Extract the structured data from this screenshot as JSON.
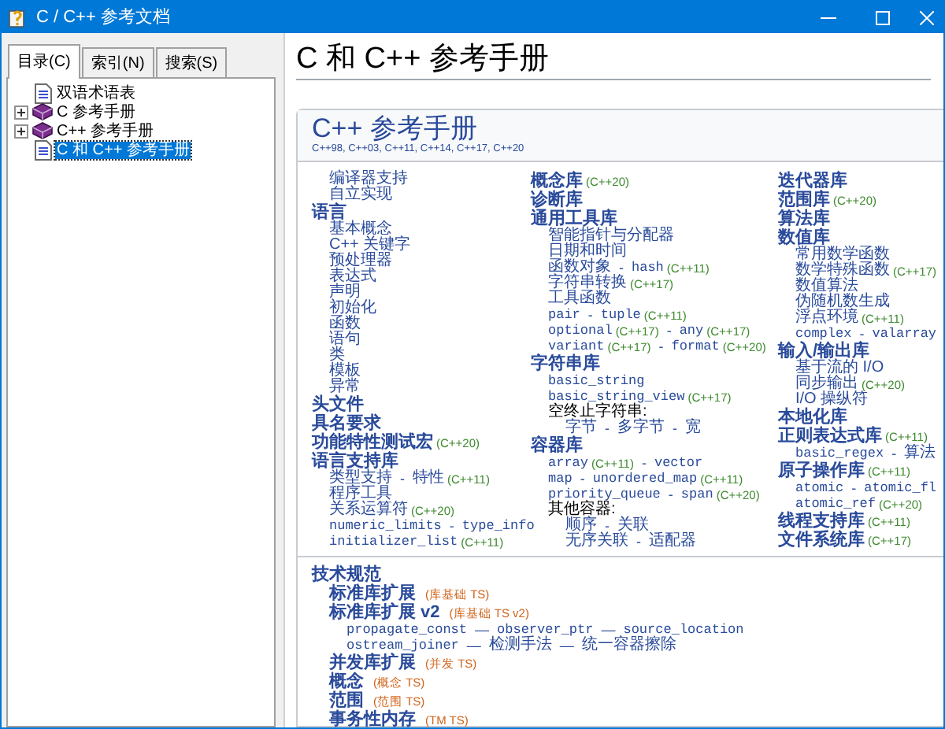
{
  "window": {
    "title": "C / C++ 参考文档"
  },
  "tabs": [
    {
      "label": "目录(C)",
      "selected": true
    },
    {
      "label": "索引(N)",
      "selected": false
    },
    {
      "label": "搜索(S)",
      "selected": false
    }
  ],
  "tree": [
    {
      "label": "双语术语表",
      "kind": "page",
      "selected": false
    },
    {
      "label": "C 参考手册",
      "kind": "book",
      "expanded": false,
      "selected": false
    },
    {
      "label": "C++ 参考手册",
      "kind": "book",
      "expanded": false,
      "selected": false
    },
    {
      "label": "C 和 C++ 参考手册",
      "kind": "page",
      "selected": true
    }
  ],
  "page": {
    "title": "C 和 C++ 参考手册",
    "panel_title": "C++ 参考手册",
    "versions": "C++98, C++03, C++11, C++14, C++17, C++20",
    "columns": [
      [
        {
          "children": [
            {
              "parts": [
                {
                  "kind": "link",
                  "text": "编译器支持"
                }
              ]
            },
            {
              "parts": [
                {
                  "kind": "link",
                  "text": "自立实现"
                }
              ]
            }
          ]
        },
        {
          "parts": [
            {
              "kind": "head",
              "text": "语言"
            }
          ],
          "children": [
            {
              "parts": [
                {
                  "kind": "link",
                  "text": "基本概念"
                }
              ]
            },
            {
              "parts": [
                {
                  "kind": "link",
                  "text": "C++ 关键字"
                }
              ]
            },
            {
              "parts": [
                {
                  "kind": "link",
                  "text": "预处理器"
                }
              ]
            },
            {
              "parts": [
                {
                  "kind": "link",
                  "text": "表达式"
                }
              ]
            },
            {
              "parts": [
                {
                  "kind": "link",
                  "text": "声明"
                }
              ]
            },
            {
              "parts": [
                {
                  "kind": "link",
                  "text": "初始化"
                }
              ]
            },
            {
              "parts": [
                {
                  "kind": "link",
                  "text": "函数"
                }
              ]
            },
            {
              "parts": [
                {
                  "kind": "link",
                  "text": "语句"
                }
              ]
            },
            {
              "parts": [
                {
                  "kind": "link",
                  "text": "类"
                }
              ]
            },
            {
              "parts": [
                {
                  "kind": "link",
                  "text": "模板"
                }
              ]
            },
            {
              "parts": [
                {
                  "kind": "link",
                  "text": "异常"
                }
              ]
            }
          ]
        },
        {
          "parts": [
            {
              "kind": "head",
              "text": "头文件"
            }
          ]
        },
        {
          "parts": [
            {
              "kind": "head",
              "text": "具名要求"
            }
          ]
        },
        {
          "parts": [
            {
              "kind": "head",
              "text": "功能特性测试宏"
            },
            {
              "kind": "ver",
              "text": "(C++20)"
            }
          ]
        },
        {
          "parts": [
            {
              "kind": "head",
              "text": "语言支持库"
            }
          ],
          "children": [
            {
              "parts": [
                {
                  "kind": "link",
                  "text": "类型支持"
                },
                {
                  "kind": "sep",
                  "text": "-"
                },
                {
                  "kind": "link",
                  "text": "特性"
                },
                {
                  "kind": "ver",
                  "text": "(C++11)"
                }
              ]
            },
            {
              "parts": [
                {
                  "kind": "link",
                  "text": "程序工具"
                }
              ]
            },
            {
              "parts": [
                {
                  "kind": "link",
                  "text": "关系运算符"
                },
                {
                  "kind": "ver",
                  "text": "(C++20)"
                }
              ]
            },
            {
              "parts": [
                {
                  "kind": "code",
                  "text": "numeric_limits"
                },
                {
                  "kind": "sep",
                  "text": "-"
                },
                {
                  "kind": "code",
                  "text": "type_info"
                }
              ]
            },
            {
              "parts": [
                {
                  "kind": "code",
                  "text": "initializer_list"
                },
                {
                  "kind": "ver",
                  "text": "(C++11)"
                }
              ]
            }
          ]
        }
      ],
      [
        {
          "parts": [
            {
              "kind": "head",
              "text": "概念库"
            },
            {
              "kind": "ver",
              "text": "(C++20)"
            }
          ]
        },
        {
          "parts": [
            {
              "kind": "head",
              "text": "诊断库"
            }
          ]
        },
        {
          "parts": [
            {
              "kind": "head",
              "text": "通用工具库"
            }
          ],
          "children": [
            {
              "parts": [
                {
                  "kind": "link",
                  "text": "智能指针与分配器"
                }
              ]
            },
            {
              "parts": [
                {
                  "kind": "link",
                  "text": "日期和时间"
                }
              ]
            },
            {
              "parts": [
                {
                  "kind": "link",
                  "text": "函数对象"
                },
                {
                  "kind": "sep",
                  "text": "-"
                },
                {
                  "kind": "code",
                  "text": "hash"
                },
                {
                  "kind": "ver",
                  "text": "(C++11)"
                }
              ]
            },
            {
              "parts": [
                {
                  "kind": "link",
                  "text": "字符串转换"
                },
                {
                  "kind": "ver",
                  "text": "(C++17)"
                }
              ]
            },
            {
              "parts": [
                {
                  "kind": "link",
                  "text": "工具函数"
                }
              ]
            },
            {
              "parts": [
                {
                  "kind": "code",
                  "text": "pair"
                },
                {
                  "kind": "sep",
                  "text": "-"
                },
                {
                  "kind": "code",
                  "text": "tuple"
                },
                {
                  "kind": "ver",
                  "text": "(C++11)"
                }
              ]
            },
            {
              "parts": [
                {
                  "kind": "code",
                  "text": "optional"
                },
                {
                  "kind": "ver",
                  "text": "(C++17)"
                },
                {
                  "kind": "sep",
                  "text": "-"
                },
                {
                  "kind": "code",
                  "text": "any"
                },
                {
                  "kind": "ver",
                  "text": "(C++17)"
                }
              ]
            },
            {
              "parts": [
                {
                  "kind": "code",
                  "text": "variant"
                },
                {
                  "kind": "ver",
                  "text": "(C++17)"
                },
                {
                  "kind": "sep",
                  "text": "-"
                },
                {
                  "kind": "code",
                  "text": "format"
                },
                {
                  "kind": "ver",
                  "text": "(C++20)"
                }
              ]
            }
          ]
        },
        {
          "parts": [
            {
              "kind": "head",
              "text": "字符串库"
            }
          ],
          "children": [
            {
              "parts": [
                {
                  "kind": "code",
                  "text": "basic_string"
                }
              ]
            },
            {
              "parts": [
                {
                  "kind": "code",
                  "text": "basic_string_view"
                },
                {
                  "kind": "ver",
                  "text": "(C++17)"
                }
              ]
            },
            {
              "parts": [
                {
                  "kind": "text",
                  "text": "空终止字符串:"
                }
              ],
              "children": [
                {
                  "parts": [
                    {
                      "kind": "link",
                      "text": "字节"
                    },
                    {
                      "kind": "sep",
                      "text": "-"
                    },
                    {
                      "kind": "link",
                      "text": "多字节"
                    },
                    {
                      "kind": "sep",
                      "text": "-"
                    },
                    {
                      "kind": "link",
                      "text": "宽"
                    }
                  ]
                }
              ]
            }
          ]
        },
        {
          "parts": [
            {
              "kind": "head",
              "text": "容器库"
            }
          ],
          "children": [
            {
              "parts": [
                {
                  "kind": "code",
                  "text": "array"
                },
                {
                  "kind": "ver",
                  "text": "(C++11)"
                },
                {
                  "kind": "sep",
                  "text": "-"
                },
                {
                  "kind": "code",
                  "text": "vector"
                }
              ]
            },
            {
              "parts": [
                {
                  "kind": "code",
                  "text": "map"
                },
                {
                  "kind": "sep",
                  "text": "-"
                },
                {
                  "kind": "code",
                  "text": "unordered_map"
                },
                {
                  "kind": "ver",
                  "text": "(C++11)"
                }
              ]
            },
            {
              "parts": [
                {
                  "kind": "code",
                  "text": "priority_queue"
                },
                {
                  "kind": "sep",
                  "text": "-"
                },
                {
                  "kind": "code",
                  "text": "span"
                },
                {
                  "kind": "ver",
                  "text": "(C++20)"
                }
              ]
            },
            {
              "parts": [
                {
                  "kind": "text",
                  "text": "其他容器:"
                }
              ],
              "children": [
                {
                  "parts": [
                    {
                      "kind": "link",
                      "text": "顺序"
                    },
                    {
                      "kind": "sep",
                      "text": "-"
                    },
                    {
                      "kind": "link",
                      "text": "关联"
                    }
                  ]
                },
                {
                  "parts": [
                    {
                      "kind": "link",
                      "text": "无序关联"
                    },
                    {
                      "kind": "sep",
                      "text": "-"
                    },
                    {
                      "kind": "link",
                      "text": "适配器"
                    }
                  ]
                }
              ]
            }
          ]
        }
      ],
      [
        {
          "parts": [
            {
              "kind": "head",
              "text": "迭代器库"
            }
          ]
        },
        {
          "parts": [
            {
              "kind": "head",
              "text": "范围库"
            },
            {
              "kind": "ver",
              "text": "(C++20)"
            }
          ]
        },
        {
          "parts": [
            {
              "kind": "head",
              "text": "算法库"
            }
          ]
        },
        {
          "parts": [
            {
              "kind": "head",
              "text": "数值库"
            }
          ],
          "children": [
            {
              "parts": [
                {
                  "kind": "link",
                  "text": "常用数学函数"
                }
              ]
            },
            {
              "parts": [
                {
                  "kind": "link",
                  "text": "数学特殊函数"
                },
                {
                  "kind": "ver",
                  "text": "(C++17)"
                }
              ]
            },
            {
              "parts": [
                {
                  "kind": "link",
                  "text": "数值算法"
                }
              ]
            },
            {
              "parts": [
                {
                  "kind": "link",
                  "text": "伪随机数生成"
                }
              ]
            },
            {
              "parts": [
                {
                  "kind": "link",
                  "text": "浮点环境"
                },
                {
                  "kind": "ver",
                  "text": "(C++11)"
                }
              ]
            },
            {
              "parts": [
                {
                  "kind": "code",
                  "text": "complex"
                },
                {
                  "kind": "sep",
                  "text": "-"
                },
                {
                  "kind": "code",
                  "text": "valarray"
                }
              ]
            }
          ]
        },
        {
          "parts": [
            {
              "kind": "head",
              "text": "输入/输出库"
            }
          ],
          "children": [
            {
              "parts": [
                {
                  "kind": "link",
                  "text": "基于流的 I/O"
                }
              ]
            },
            {
              "parts": [
                {
                  "kind": "link",
                  "text": "同步输出"
                },
                {
                  "kind": "ver",
                  "text": "(C++20)"
                }
              ]
            },
            {
              "parts": [
                {
                  "kind": "link",
                  "text": "I/O 操纵符"
                }
              ]
            }
          ]
        },
        {
          "parts": [
            {
              "kind": "head",
              "text": "本地化库"
            }
          ]
        },
        {
          "parts": [
            {
              "kind": "head",
              "text": "正则表达式库"
            },
            {
              "kind": "ver",
              "text": "(C++11)"
            }
          ],
          "children": [
            {
              "parts": [
                {
                  "kind": "code",
                  "text": "basic_regex"
                },
                {
                  "kind": "sep",
                  "text": "-"
                },
                {
                  "kind": "link",
                  "text": "算法"
                }
              ]
            }
          ]
        },
        {
          "parts": [
            {
              "kind": "head",
              "text": "原子操作库"
            },
            {
              "kind": "ver",
              "text": "(C++11)"
            }
          ],
          "children": [
            {
              "parts": [
                {
                  "kind": "code",
                  "text": "atomic"
                },
                {
                  "kind": "sep",
                  "text": "-"
                },
                {
                  "kind": "code",
                  "text": "atomic_fl"
                }
              ]
            },
            {
              "parts": [
                {
                  "kind": "code",
                  "text": "atomic_ref"
                },
                {
                  "kind": "ver",
                  "text": "(C++20)"
                }
              ]
            }
          ]
        },
        {
          "parts": [
            {
              "kind": "head",
              "text": "线程支持库"
            },
            {
              "kind": "ver",
              "text": "(C++11)"
            }
          ]
        },
        {
          "parts": [
            {
              "kind": "head",
              "text": "文件系统库"
            },
            {
              "kind": "ver",
              "text": "(C++17)"
            }
          ]
        }
      ]
    ],
    "specs": [
      {
        "parts": [
          {
            "kind": "head",
            "text": "技术规范"
          }
        ],
        "children": [
          {
            "parts": [
              {
                "kind": "head",
                "text": "标准库扩展"
              },
              {
                "kind": "ts",
                "text": "(库基础 TS)"
              }
            ]
          },
          {
            "parts": [
              {
                "kind": "head",
                "text": "标准库扩展 v2"
              },
              {
                "kind": "ts",
                "text": "(库基础 TS v2)"
              }
            ],
            "children": [
              {
                "parts": [
                  {
                    "kind": "code",
                    "text": "propagate_const"
                  },
                  {
                    "kind": "sep",
                    "text": "—"
                  },
                  {
                    "kind": "code",
                    "text": "observer_ptr"
                  },
                  {
                    "kind": "sep",
                    "text": "—"
                  },
                  {
                    "kind": "code",
                    "text": "source_location"
                  }
                ]
              },
              {
                "parts": [
                  {
                    "kind": "code",
                    "text": "ostream_joiner"
                  },
                  {
                    "kind": "sep",
                    "text": "—"
                  },
                  {
                    "kind": "link",
                    "text": "检测手法"
                  },
                  {
                    "kind": "sep",
                    "text": "—"
                  },
                  {
                    "kind": "link",
                    "text": "统一容器擦除"
                  }
                ]
              }
            ]
          },
          {
            "parts": [
              {
                "kind": "head",
                "text": "并发库扩展"
              },
              {
                "kind": "ts",
                "text": "(并发 TS)"
              }
            ]
          },
          {
            "parts": [
              {
                "kind": "head",
                "text": "概念"
              },
              {
                "kind": "ts",
                "text": "(概念 TS)"
              }
            ]
          },
          {
            "parts": [
              {
                "kind": "head",
                "text": "范围"
              },
              {
                "kind": "ts",
                "text": "(范围 TS)"
              }
            ]
          },
          {
            "parts": [
              {
                "kind": "head",
                "text": "事务性内存"
              },
              {
                "kind": "ts",
                "text": "(TM TS)"
              }
            ]
          }
        ]
      }
    ]
  }
}
